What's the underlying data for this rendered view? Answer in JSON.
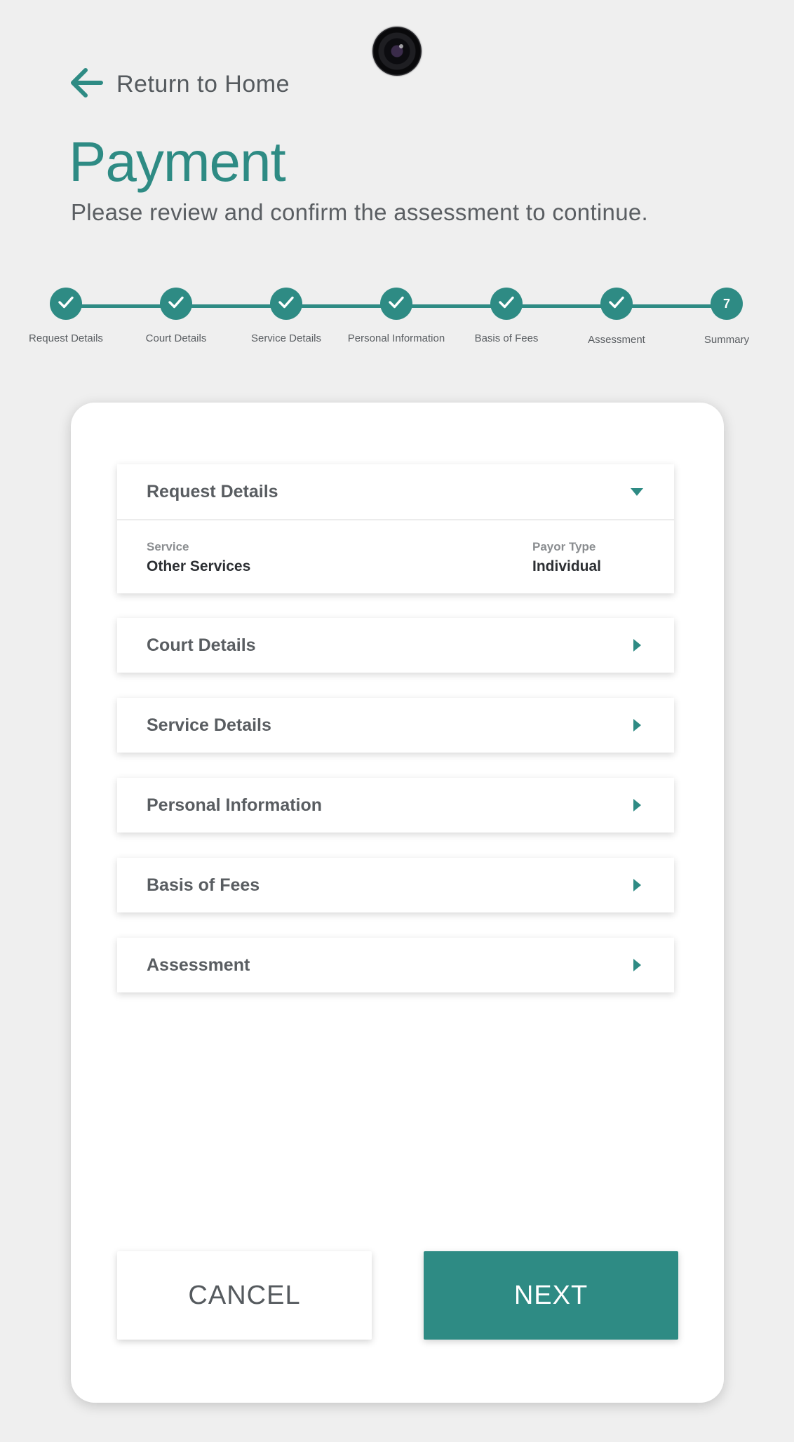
{
  "nav": {
    "back_label": "Return to Home"
  },
  "header": {
    "title": "Payment",
    "subtitle": "Please review and confirm the assessment to continue."
  },
  "stepper": {
    "steps": [
      {
        "label": "Request Details",
        "state": "complete"
      },
      {
        "label": "Court Details",
        "state": "complete"
      },
      {
        "label": "Service Details",
        "state": "complete"
      },
      {
        "label": "Personal Information",
        "state": "complete"
      },
      {
        "label": "Basis of Fees",
        "state": "complete"
      },
      {
        "label": "Assessment",
        "state": "complete"
      },
      {
        "label": "Summary",
        "state": "current",
        "number": "7"
      }
    ]
  },
  "sections": {
    "request_details": {
      "title": "Request Details",
      "expanded": true,
      "fields": {
        "service_label": "Service",
        "service_value": "Other Services",
        "payor_label": "Payor Type",
        "payor_value": "Individual"
      }
    },
    "court_details": {
      "title": "Court Details",
      "expanded": false
    },
    "service_details": {
      "title": "Service Details",
      "expanded": false
    },
    "personal_information": {
      "title": "Personal Information",
      "expanded": false
    },
    "basis_of_fees": {
      "title": "Basis of Fees",
      "expanded": false
    },
    "assessment": {
      "title": "Assessment",
      "expanded": false
    }
  },
  "actions": {
    "cancel_label": "CANCEL",
    "next_label": "NEXT"
  },
  "colors": {
    "accent": "#2e8b84",
    "background": "#efefef",
    "text": "#555a5e"
  }
}
